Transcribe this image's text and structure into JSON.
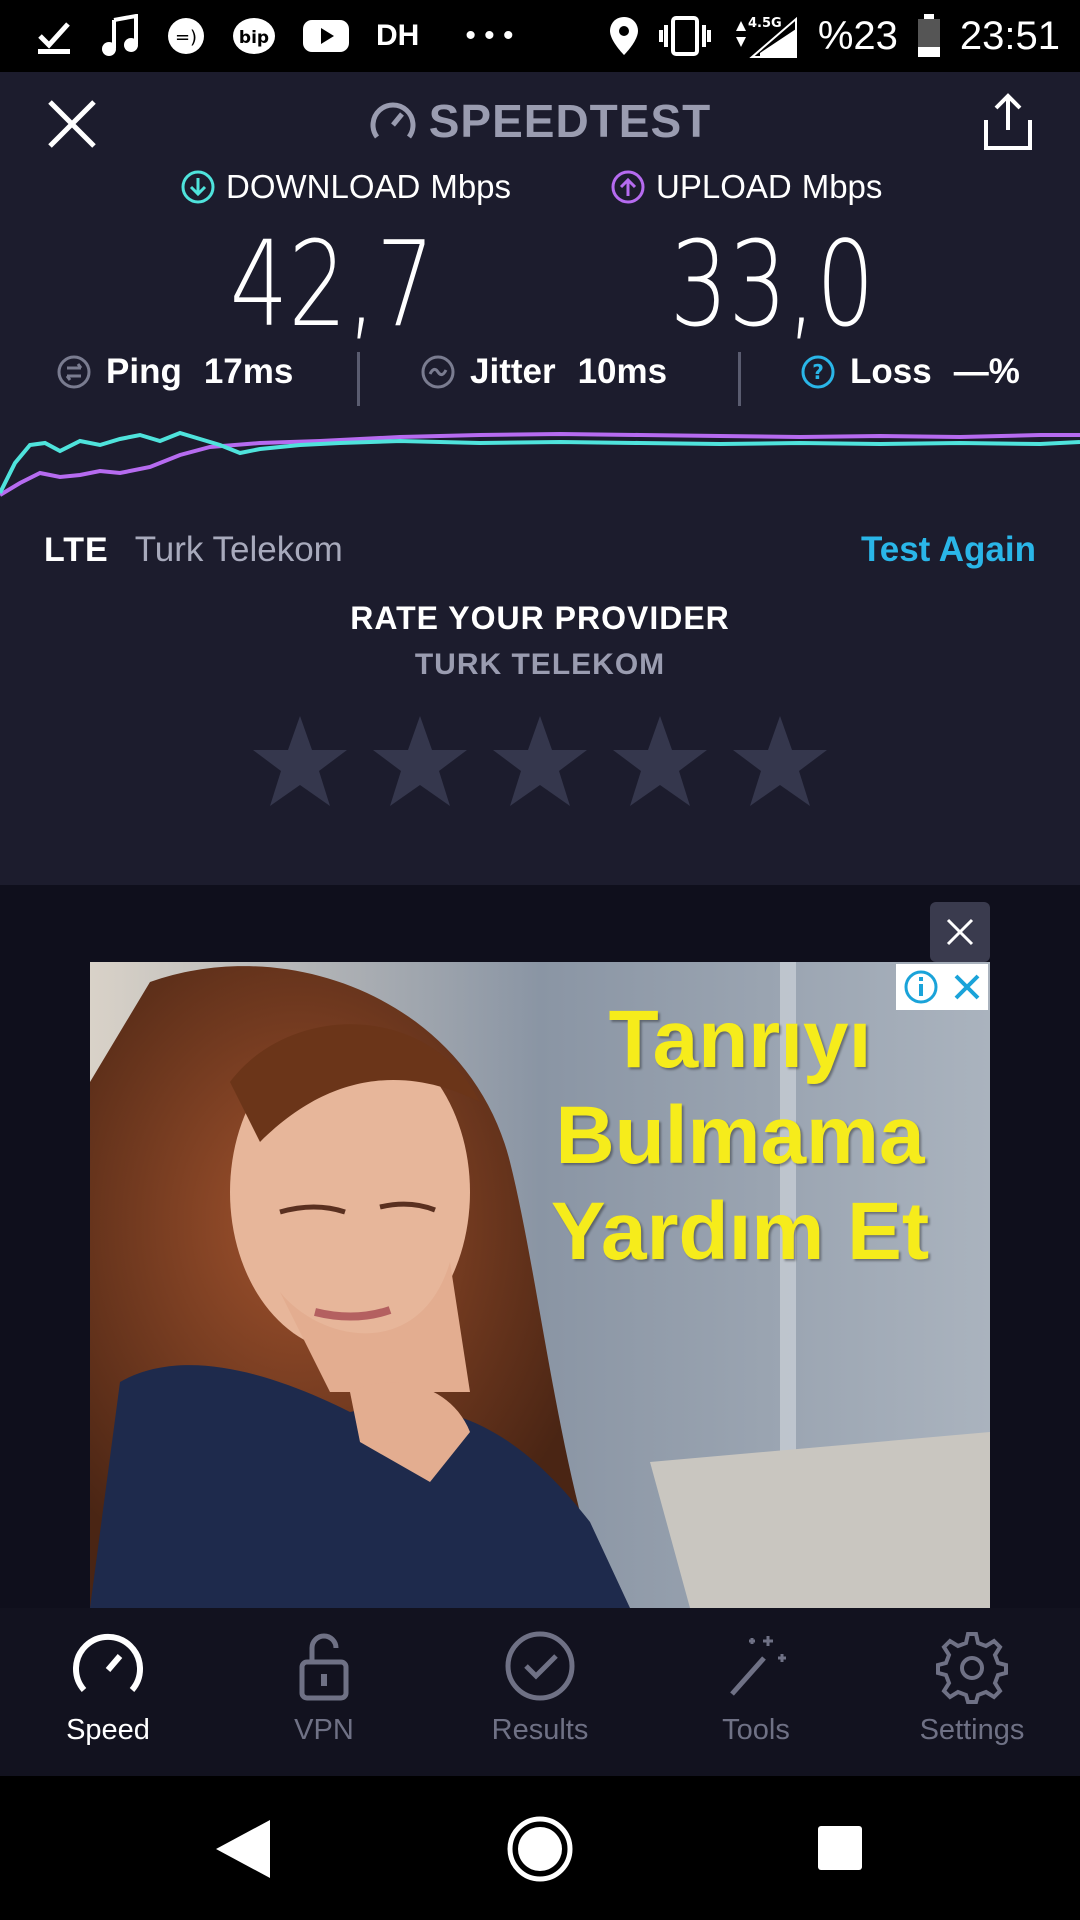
{
  "status_bar": {
    "carrier_label": "DH",
    "network": "4.5G",
    "battery": "%23",
    "time": "23:51"
  },
  "header": {
    "title": "SPEEDTEST"
  },
  "results": {
    "download_label": "DOWNLOAD",
    "upload_label": "UPLOAD",
    "unit": "Mbps",
    "download_value": "42,7",
    "upload_value": "33,0",
    "ping_label": "Ping",
    "ping_value": "17ms",
    "jitter_label": "Jitter",
    "jitter_value": "10ms",
    "loss_label": "Loss",
    "loss_value": "—%"
  },
  "connection": {
    "type": "LTE",
    "provider": "Turk Telekom",
    "test_again": "Test Again"
  },
  "rating": {
    "title": "RATE YOUR PROVIDER",
    "provider": "TURK TELEKOM",
    "stars": 5
  },
  "ad": {
    "headline_lines": [
      "Tanrıyı",
      "Bulmama",
      "Yardım Et"
    ]
  },
  "tabs": [
    {
      "label": "Speed",
      "icon": "speed-gauge-icon",
      "active": true
    },
    {
      "label": "VPN",
      "icon": "lock-icon",
      "active": false
    },
    {
      "label": "Results",
      "icon": "check-circle-icon",
      "active": false
    },
    {
      "label": "Tools",
      "icon": "magic-wand-icon",
      "active": false
    },
    {
      "label": "Settings",
      "icon": "gear-icon",
      "active": false
    }
  ],
  "colors": {
    "background": "#1c1c2d",
    "download_accent": "#4fe3dc",
    "upload_accent": "#b66bf0",
    "link": "#2ab6e8"
  }
}
